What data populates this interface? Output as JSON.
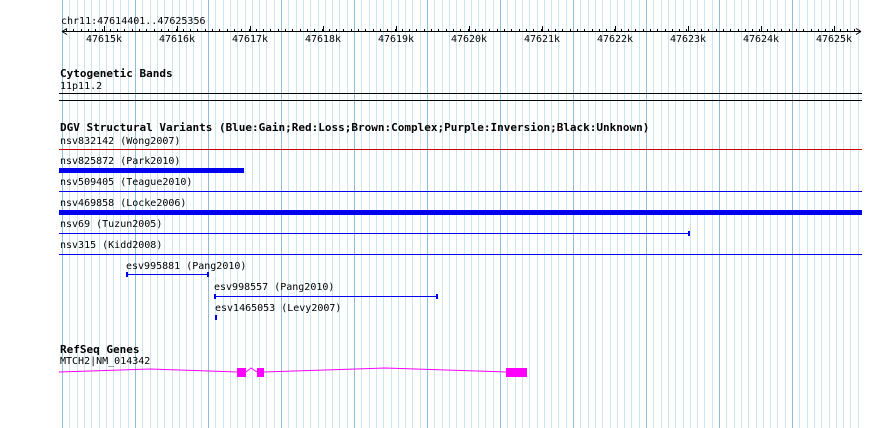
{
  "ruler": {
    "location": "chr11:47614401..47625356",
    "tick_labels": [
      "47615k",
      "47616k",
      "47617k",
      "47618k",
      "47619k",
      "47620k",
      "47621k",
      "47622k",
      "47623k",
      "47624k",
      "47625k"
    ]
  },
  "cytogenetic": {
    "title": "Cytogenetic Bands",
    "band": "11p11.2"
  },
  "dgv": {
    "title": "DGV Structural Variants (Blue:Gain;Red:Loss;Brown:Complex;Purple:Inversion;Black:Unknown)",
    "variants": [
      {
        "label": "nsv832142 (Wong2007)",
        "color": "#cc0000"
      },
      {
        "label": "nsv825872 (Park2010)",
        "color": "#0000ee"
      },
      {
        "label": "nsv509405 (Teague2010)",
        "color": "#0000ee"
      },
      {
        "label": "nsv469858 (Locke2006)",
        "color": "#0000ee"
      },
      {
        "label": "nsv69 (Tuzun2005)",
        "color": "#0000ee"
      },
      {
        "label": "nsv315 (Kidd2008)",
        "color": "#0000ee"
      },
      {
        "label": "esv995881 (Pang2010)",
        "color": "#0000ee"
      },
      {
        "label": "esv998557 (Pang2010)",
        "color": "#0000ee"
      },
      {
        "label": "esv1465053 (Levy2007)",
        "color": "#0000ee"
      }
    ]
  },
  "refseq": {
    "title": "RefSeq Genes",
    "gene_label": "MTCH2|NM_014342",
    "color": "#ff00ff"
  }
}
